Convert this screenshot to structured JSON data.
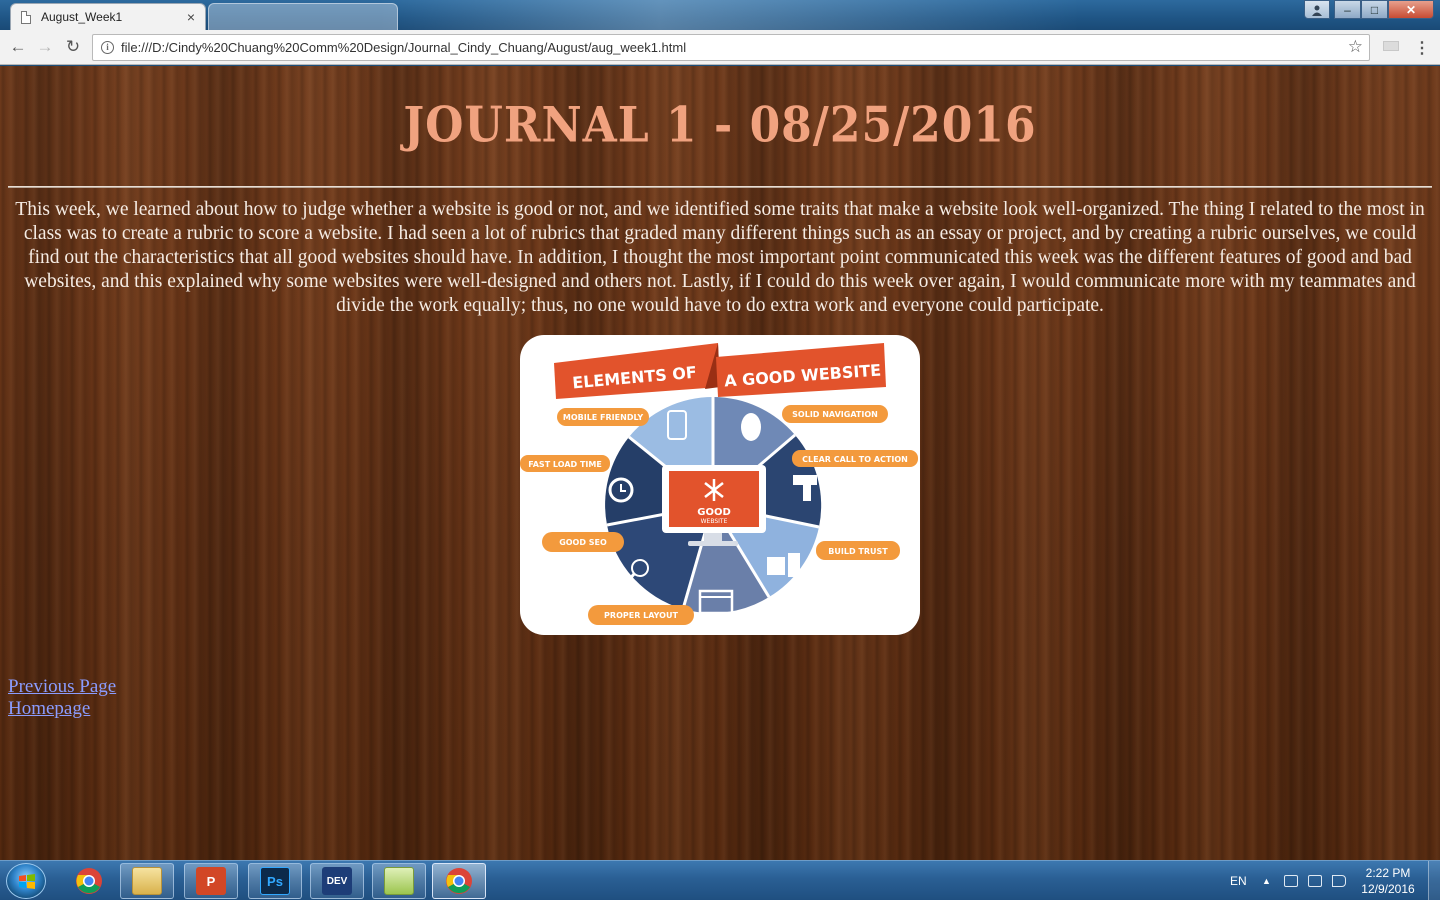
{
  "browser": {
    "active_tab_title": "August_Week1",
    "tab_close": "×",
    "address": "file:///D:/Cindy%20Chuang%20Comm%20Design/Journal_Cindy_Chuang/August/aug_week1.html"
  },
  "window": {
    "minimize": "–",
    "maximize": "□",
    "close": "✕"
  },
  "page": {
    "title": "JOURNAL 1 - 08/25/2016",
    "body": "This week, we learned about how to judge whether a website is good or not, and we identified some traits that make a website look well-organized. The thing I related to the most in class was to create a rubric to score a website. I had seen a lot of rubrics that graded many different things such as an essay or project, and by creating a rubric ourselves, we could find out the characteristics that all good websites should have. In addition, I thought the most important point communicated this week was the different features of good and bad websites, and this explained why some websites were well-designed and others not. Lastly, if I could do this week over again, I would communicate more with my teammates and divide the work equally; thus, no one would have to do extra work and everyone could participate.",
    "links": {
      "previous": "Previous Page",
      "home": "Homepage"
    },
    "infographic": {
      "banner_left": "ELEMENTS OF",
      "banner_right": "A GOOD WEBSITE",
      "center_line1": "GOOD",
      "center_line2": "WEBSITE",
      "labels": {
        "mobile": "MOBILE FRIENDLY",
        "navigation": "SOLID NAVIGATION",
        "load": "FAST LOAD TIME",
        "cta": "CLEAR CALL TO ACTION",
        "seo": "GOOD SEO",
        "trust": "BUILD TRUST",
        "layout": "PROPER LAYOUT"
      }
    }
  },
  "taskbar": {
    "apps": [
      "Google Chrome",
      "Windows Explorer",
      "PowerPoint",
      "Photoshop",
      "Dev-C++",
      "Notepad",
      "Google Chrome"
    ],
    "ppt_label": "P",
    "ps_label": "Ps",
    "dev_label": "DEV",
    "language": "EN",
    "time": "2:22 PM",
    "date": "12/9/2016"
  }
}
